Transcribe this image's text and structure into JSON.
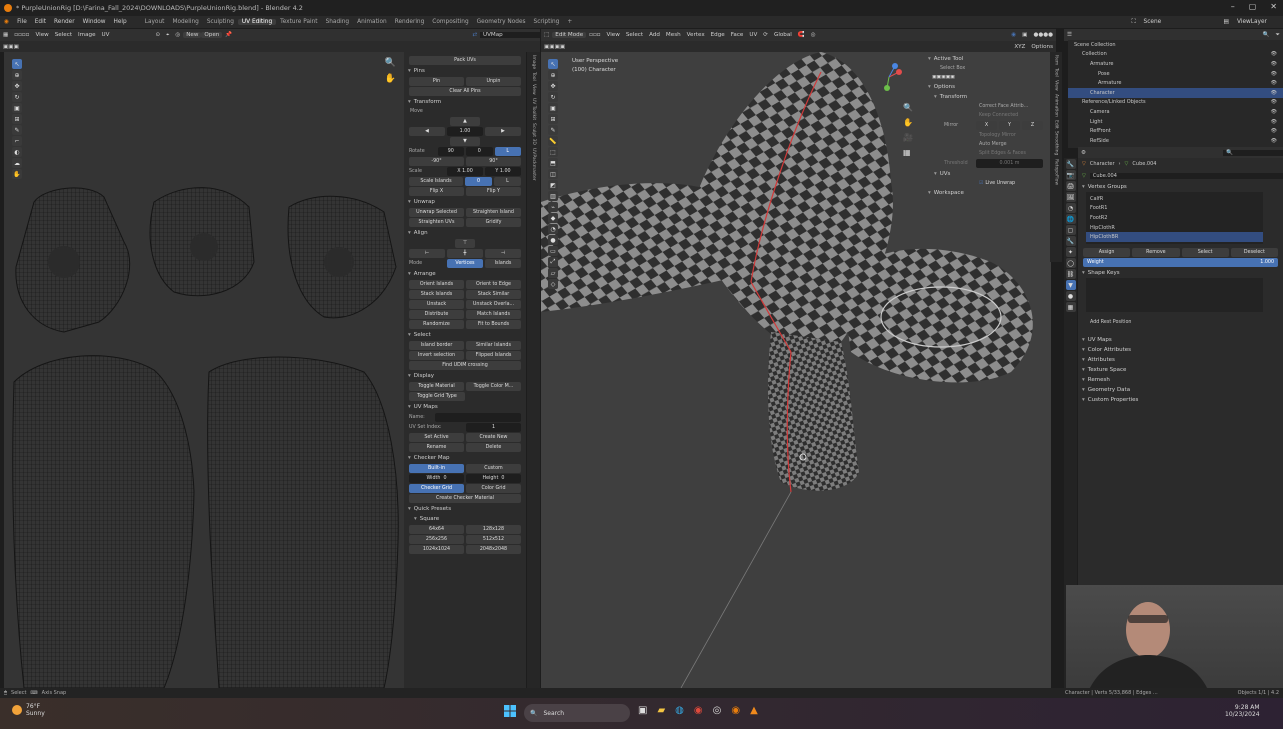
{
  "window": {
    "title": "* PurpleUnionRig [D:\\Farina_Fall_2024\\DOWNLOADS\\PurpleUnionRig.blend] - Blender 4.2"
  },
  "menu": {
    "items": [
      "File",
      "Edit",
      "Render",
      "Window",
      "Help"
    ],
    "workspaces": [
      "Layout",
      "Modeling",
      "Sculpting",
      "UV Editing",
      "Texture Paint",
      "Shading",
      "Animation",
      "Rendering",
      "Compositing",
      "Geometry Nodes",
      "Scripting"
    ],
    "active_workspace": "UV Editing",
    "add_tab": "+",
    "scene_label": "Scene",
    "viewlayer_label": "ViewLayer"
  },
  "uv_header": {
    "menus": [
      "View",
      "Select",
      "Image",
      "UV"
    ],
    "new_label": "New",
    "open_label": "Open",
    "uvmap_value": "UVMap"
  },
  "uv_panel": {
    "pack_uvs": "Pack UVs",
    "pins": {
      "title": "Pins",
      "pin": "Pin",
      "unpin": "Unpin",
      "clear_all": "Clear All Pins"
    },
    "transform": {
      "title": "Transform",
      "move": "Move",
      "move_value": "1.00",
      "rotate_label": "Rotate",
      "rotate_value": "90",
      "rotate_zero": "0",
      "l_toggle": "L",
      "rot_neg": "-90°",
      "rot_pos": "90°",
      "scale_label": "Scale",
      "scale_x": "X",
      "scale_x_val": "1.00",
      "scale_y": "Y",
      "scale_y_val": "1.00",
      "scale_islands": "Scale Islands",
      "scale_islands_val": "0",
      "flip_x": "Flip X",
      "flip_y": "Flip Y"
    },
    "unwrap": {
      "title": "Unwrap",
      "unwrap_selected": "Unwrap Selected",
      "straighten_island": "Straighten Island",
      "straighten_uvs": "Straighten UVs",
      "gridify": "Gridify"
    },
    "align": {
      "title": "Align",
      "mode_label": "Mode",
      "vertices": "Vertices",
      "islands": "Islands"
    },
    "arrange": {
      "title": "Arrange",
      "items": [
        "Orient Islands",
        "Orient to Edge",
        "Stack Islands",
        "Stack Similar",
        "Unstack",
        "Unstack Overla...",
        "Distribute",
        "Match Islands",
        "Randomize",
        "Fit to Bounds"
      ]
    },
    "select": {
      "title": "Select",
      "items": [
        "Island border",
        "Similar Islands",
        "Invert selection",
        "Flipped Islands"
      ],
      "find_udim": "Find UDIM crossing"
    },
    "display": {
      "title": "Display",
      "toggle_material": "Toggle Material",
      "toggle_color": "Toggle Color M...",
      "toggle_grid": "Toggle Grid Type"
    },
    "uv_maps": {
      "title": "UV Maps",
      "name_label": "Name:",
      "set_index_label": "UV Set Index:",
      "set_index_value": "1",
      "set_active": "Set Active",
      "create_new": "Create New",
      "rename": "Rename",
      "delete": "Delete"
    },
    "checker": {
      "title": "Checker Map",
      "built_in": "Built-in",
      "custom": "Custom",
      "width_label": "Width",
      "width_val": "0",
      "height_label": "Height",
      "height_val": "0",
      "checker_grid": "Checker Grid",
      "color_grid": "Color Grid",
      "create_material": "Create Checker Material"
    },
    "presets": {
      "title": "Quick Presets",
      "square": "Square",
      "sizes": [
        "64x64",
        "128x128",
        "256x256",
        "512x512",
        "1024x1024",
        "2048x2048"
      ]
    }
  },
  "side_tabs": [
    "Image",
    "Tool",
    "View",
    "UV Toolkit",
    "Sculpt 3D",
    "UVPackmaster"
  ],
  "viewport": {
    "header_menus": [
      "View",
      "Select",
      "Add",
      "Mesh",
      "Vertex",
      "Edge",
      "Face",
      "UV"
    ],
    "mode": "Edit Mode",
    "transform_orientation": "Global",
    "options_label": "Options",
    "view_name": "User Perspective",
    "object_name": "(100) Character",
    "side_tabs": [
      "Item",
      "Tool",
      "View",
      "Animation",
      "Edit",
      "Smoothing",
      "RetopoFlow"
    ]
  },
  "tool_panel": {
    "active_tool": "Active Tool",
    "select_box": "Select Box",
    "options": "Options",
    "transform": "Transform",
    "correct_face": "Correct Face Attrib...",
    "keep_connected": "Keep Connected",
    "mirror_label": "Mirror",
    "mirror_axes": [
      "X",
      "Y",
      "Z"
    ],
    "topology_mirror": "Topology Mirror",
    "auto_merge": "Auto Merge",
    "split_edges": "Split Edges & Faces",
    "threshold_label": "Threshold",
    "threshold_val": "0.001 m",
    "uvs": "UVs",
    "live_unwrap": "Live Unwrap",
    "workspace": "Workspace"
  },
  "outliner": {
    "title": "Scene Collection",
    "items": [
      {
        "label": "Collection",
        "depth": 1,
        "sel": false
      },
      {
        "label": "Armature",
        "depth": 2,
        "sel": false
      },
      {
        "label": "Pose",
        "depth": 3,
        "sel": false
      },
      {
        "label": "Armature",
        "depth": 3,
        "sel": false
      },
      {
        "label": "Character",
        "depth": 2,
        "sel": true
      },
      {
        "label": "Reference/Linked Objects",
        "depth": 1,
        "sel": false
      },
      {
        "label": "Camera",
        "depth": 2,
        "sel": false
      },
      {
        "label": "Light",
        "depth": 2,
        "sel": false
      },
      {
        "label": "RefFront",
        "depth": 2,
        "sel": false
      },
      {
        "label": "RefSide",
        "depth": 2,
        "sel": false
      }
    ]
  },
  "properties": {
    "breadcrumb_object": "Character",
    "breadcrumb_mesh": "Cube.004",
    "mesh_name": "Cube.004",
    "vertex_groups_title": "Vertex Groups",
    "vertex_groups": [
      "CalfR",
      "FootR1",
      "FootR2",
      "HipClothR",
      "HipClothBR"
    ],
    "selected_group": "HipClothBR",
    "assign": "Assign",
    "remove": "Remove",
    "select": "Select",
    "deselect": "Deselect",
    "weight_label": "Weight",
    "weight_value": "1.000",
    "shape_keys": "Shape Keys",
    "add_rest": "Add Rest Position",
    "sections": [
      "UV Maps",
      "Color Attributes",
      "Attributes",
      "Texture Space",
      "Remesh",
      "Geometry Data",
      "Custom Properties"
    ]
  },
  "status": {
    "left_items": [
      "Select",
      "Axis Snap"
    ],
    "right_text": "Character | Verts 5/33,868 | Edges ...",
    "objects_text": "Objects 1/1 | 4.2"
  },
  "taskbar": {
    "temperature": "76°F",
    "weather": "Sunny",
    "search_placeholder": "Search",
    "time": "9:28 AM",
    "date": "10/23/2024"
  },
  "colors": {
    "accent": "#4772b3",
    "orange": "#e87d0d",
    "selected_row": "#334d80"
  }
}
